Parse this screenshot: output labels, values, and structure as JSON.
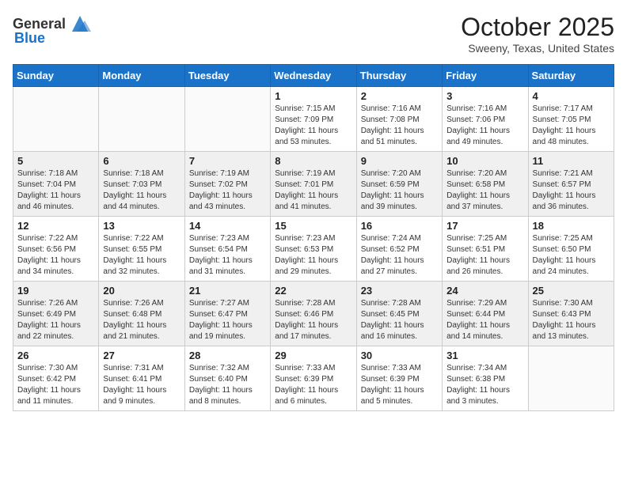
{
  "header": {
    "logo_general": "General",
    "logo_blue": "Blue",
    "month": "October 2025",
    "location": "Sweeny, Texas, United States"
  },
  "weekdays": [
    "Sunday",
    "Monday",
    "Tuesday",
    "Wednesday",
    "Thursday",
    "Friday",
    "Saturday"
  ],
  "weeks": [
    [
      {
        "day": "",
        "sunrise": "",
        "sunset": "",
        "daylight": ""
      },
      {
        "day": "",
        "sunrise": "",
        "sunset": "",
        "daylight": ""
      },
      {
        "day": "",
        "sunrise": "",
        "sunset": "",
        "daylight": ""
      },
      {
        "day": "1",
        "sunrise": "Sunrise: 7:15 AM",
        "sunset": "Sunset: 7:09 PM",
        "daylight": "Daylight: 11 hours and 53 minutes."
      },
      {
        "day": "2",
        "sunrise": "Sunrise: 7:16 AM",
        "sunset": "Sunset: 7:08 PM",
        "daylight": "Daylight: 11 hours and 51 minutes."
      },
      {
        "day": "3",
        "sunrise": "Sunrise: 7:16 AM",
        "sunset": "Sunset: 7:06 PM",
        "daylight": "Daylight: 11 hours and 49 minutes."
      },
      {
        "day": "4",
        "sunrise": "Sunrise: 7:17 AM",
        "sunset": "Sunset: 7:05 PM",
        "daylight": "Daylight: 11 hours and 48 minutes."
      }
    ],
    [
      {
        "day": "5",
        "sunrise": "Sunrise: 7:18 AM",
        "sunset": "Sunset: 7:04 PM",
        "daylight": "Daylight: 11 hours and 46 minutes."
      },
      {
        "day": "6",
        "sunrise": "Sunrise: 7:18 AM",
        "sunset": "Sunset: 7:03 PM",
        "daylight": "Daylight: 11 hours and 44 minutes."
      },
      {
        "day": "7",
        "sunrise": "Sunrise: 7:19 AM",
        "sunset": "Sunset: 7:02 PM",
        "daylight": "Daylight: 11 hours and 43 minutes."
      },
      {
        "day": "8",
        "sunrise": "Sunrise: 7:19 AM",
        "sunset": "Sunset: 7:01 PM",
        "daylight": "Daylight: 11 hours and 41 minutes."
      },
      {
        "day": "9",
        "sunrise": "Sunrise: 7:20 AM",
        "sunset": "Sunset: 6:59 PM",
        "daylight": "Daylight: 11 hours and 39 minutes."
      },
      {
        "day": "10",
        "sunrise": "Sunrise: 7:20 AM",
        "sunset": "Sunset: 6:58 PM",
        "daylight": "Daylight: 11 hours and 37 minutes."
      },
      {
        "day": "11",
        "sunrise": "Sunrise: 7:21 AM",
        "sunset": "Sunset: 6:57 PM",
        "daylight": "Daylight: 11 hours and 36 minutes."
      }
    ],
    [
      {
        "day": "12",
        "sunrise": "Sunrise: 7:22 AM",
        "sunset": "Sunset: 6:56 PM",
        "daylight": "Daylight: 11 hours and 34 minutes."
      },
      {
        "day": "13",
        "sunrise": "Sunrise: 7:22 AM",
        "sunset": "Sunset: 6:55 PM",
        "daylight": "Daylight: 11 hours and 32 minutes."
      },
      {
        "day": "14",
        "sunrise": "Sunrise: 7:23 AM",
        "sunset": "Sunset: 6:54 PM",
        "daylight": "Daylight: 11 hours and 31 minutes."
      },
      {
        "day": "15",
        "sunrise": "Sunrise: 7:23 AM",
        "sunset": "Sunset: 6:53 PM",
        "daylight": "Daylight: 11 hours and 29 minutes."
      },
      {
        "day": "16",
        "sunrise": "Sunrise: 7:24 AM",
        "sunset": "Sunset: 6:52 PM",
        "daylight": "Daylight: 11 hours and 27 minutes."
      },
      {
        "day": "17",
        "sunrise": "Sunrise: 7:25 AM",
        "sunset": "Sunset: 6:51 PM",
        "daylight": "Daylight: 11 hours and 26 minutes."
      },
      {
        "day": "18",
        "sunrise": "Sunrise: 7:25 AM",
        "sunset": "Sunset: 6:50 PM",
        "daylight": "Daylight: 11 hours and 24 minutes."
      }
    ],
    [
      {
        "day": "19",
        "sunrise": "Sunrise: 7:26 AM",
        "sunset": "Sunset: 6:49 PM",
        "daylight": "Daylight: 11 hours and 22 minutes."
      },
      {
        "day": "20",
        "sunrise": "Sunrise: 7:26 AM",
        "sunset": "Sunset: 6:48 PM",
        "daylight": "Daylight: 11 hours and 21 minutes."
      },
      {
        "day": "21",
        "sunrise": "Sunrise: 7:27 AM",
        "sunset": "Sunset: 6:47 PM",
        "daylight": "Daylight: 11 hours and 19 minutes."
      },
      {
        "day": "22",
        "sunrise": "Sunrise: 7:28 AM",
        "sunset": "Sunset: 6:46 PM",
        "daylight": "Daylight: 11 hours and 17 minutes."
      },
      {
        "day": "23",
        "sunrise": "Sunrise: 7:28 AM",
        "sunset": "Sunset: 6:45 PM",
        "daylight": "Daylight: 11 hours and 16 minutes."
      },
      {
        "day": "24",
        "sunrise": "Sunrise: 7:29 AM",
        "sunset": "Sunset: 6:44 PM",
        "daylight": "Daylight: 11 hours and 14 minutes."
      },
      {
        "day": "25",
        "sunrise": "Sunrise: 7:30 AM",
        "sunset": "Sunset: 6:43 PM",
        "daylight": "Daylight: 11 hours and 13 minutes."
      }
    ],
    [
      {
        "day": "26",
        "sunrise": "Sunrise: 7:30 AM",
        "sunset": "Sunset: 6:42 PM",
        "daylight": "Daylight: 11 hours and 11 minutes."
      },
      {
        "day": "27",
        "sunrise": "Sunrise: 7:31 AM",
        "sunset": "Sunset: 6:41 PM",
        "daylight": "Daylight: 11 hours and 9 minutes."
      },
      {
        "day": "28",
        "sunrise": "Sunrise: 7:32 AM",
        "sunset": "Sunset: 6:40 PM",
        "daylight": "Daylight: 11 hours and 8 minutes."
      },
      {
        "day": "29",
        "sunrise": "Sunrise: 7:33 AM",
        "sunset": "Sunset: 6:39 PM",
        "daylight": "Daylight: 11 hours and 6 minutes."
      },
      {
        "day": "30",
        "sunrise": "Sunrise: 7:33 AM",
        "sunset": "Sunset: 6:39 PM",
        "daylight": "Daylight: 11 hours and 5 minutes."
      },
      {
        "day": "31",
        "sunrise": "Sunrise: 7:34 AM",
        "sunset": "Sunset: 6:38 PM",
        "daylight": "Daylight: 11 hours and 3 minutes."
      },
      {
        "day": "",
        "sunrise": "",
        "sunset": "",
        "daylight": ""
      }
    ]
  ]
}
